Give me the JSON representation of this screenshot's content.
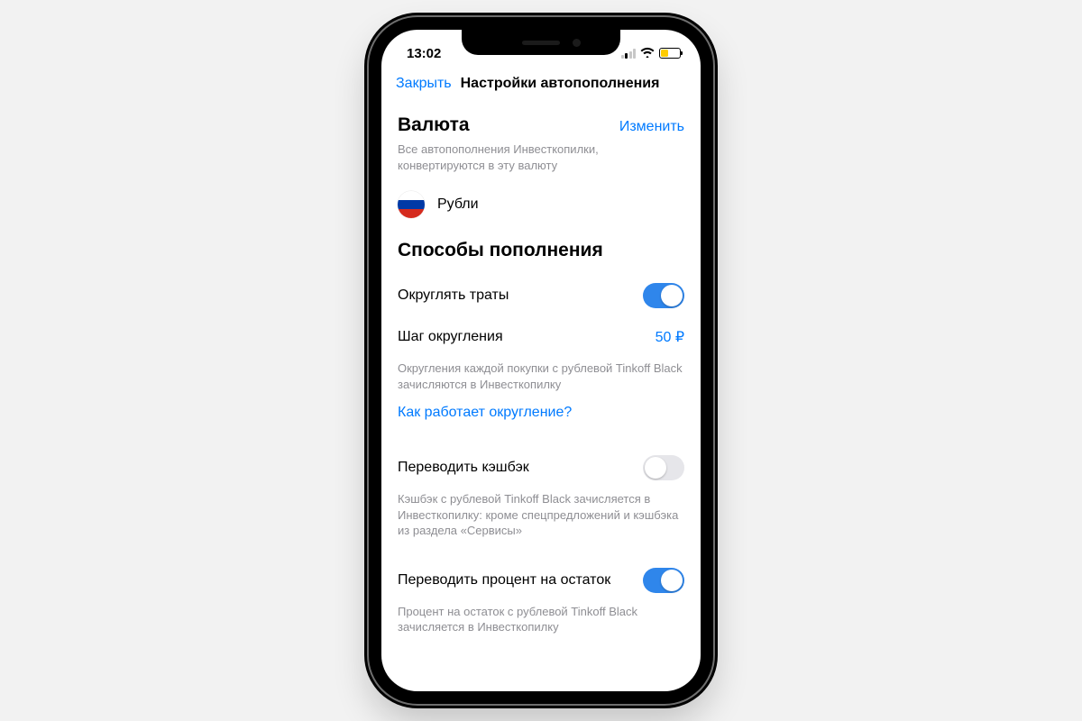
{
  "status": {
    "time": "13:02"
  },
  "nav": {
    "close": "Закрыть",
    "title": "Настройки автопополнения"
  },
  "currency": {
    "heading": "Валюта",
    "change": "Изменить",
    "description": "Все автопополнения Инвесткопилки, конвертируются в эту валюту",
    "name": "Рубли",
    "flag": "ru"
  },
  "methods": {
    "heading": "Способы пополнения",
    "rounding": {
      "label": "Округлять траты",
      "enabled": true,
      "step_label": "Шаг округления",
      "step_value": "50 ₽",
      "description": "Округления каждой покупки с рублевой Tinkoff Black зачисляются в Инвесткопилку",
      "help_link": "Как работает округление?"
    },
    "cashback": {
      "label": "Переводить кэшбэк",
      "enabled": false,
      "description": "Кэшбэк с рублевой Tinkoff Black зачисляется в Инвесткопилку: кроме спецпредложений и кэшбэка из раздела «Сервисы»"
    },
    "interest": {
      "label": "Переводить процент на остаток",
      "enabled": true,
      "description": "Процент на остаток с рублевой Tinkoff Black зачисляется в Инвесткопилку"
    }
  }
}
